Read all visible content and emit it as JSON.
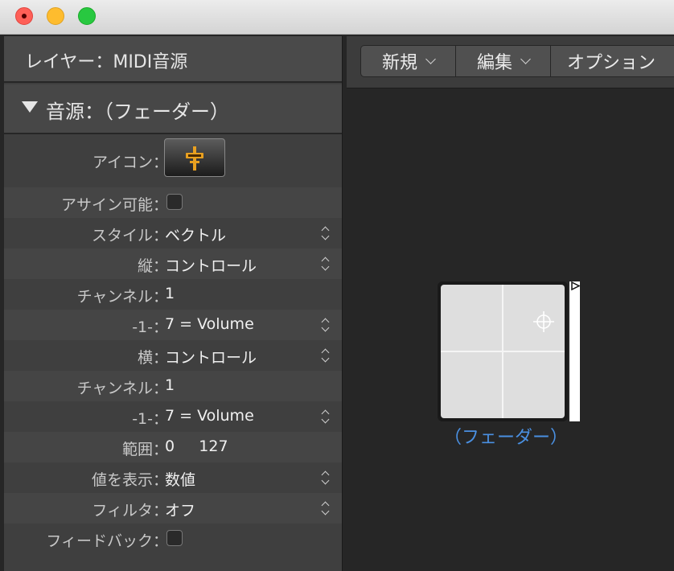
{
  "window": {
    "traffic_lights": [
      "close",
      "minimize",
      "zoom"
    ]
  },
  "inspector": {
    "header_title": "レイヤー：MIDI音源",
    "section_title": "音源：（フェーダー）",
    "rows": [
      {
        "label": "アイコン：",
        "type": "icon",
        "icon": "fader-icon"
      },
      {
        "label": "アサイン可能：",
        "type": "checkbox",
        "checked": false
      },
      {
        "label": "スタイル：",
        "value": "ベクトル",
        "type": "popup"
      },
      {
        "label": "縦：",
        "value": "コントロール",
        "type": "popup"
      },
      {
        "label": "チャンネル：",
        "value": "1",
        "type": "text"
      },
      {
        "label": "-1-：",
        "value": "7 = Volume",
        "type": "popup"
      },
      {
        "label": "横：",
        "value": "コントロール",
        "type": "popup"
      },
      {
        "label": "チャンネル：",
        "value": "1",
        "type": "text"
      },
      {
        "label": "-1-：",
        "value": "7 = Volume",
        "type": "popup"
      },
      {
        "label": "範囲：",
        "value": "0     127",
        "type": "text"
      },
      {
        "label": "値を表示：",
        "value": "数値",
        "type": "popup"
      },
      {
        "label": "フィルタ：",
        "value": "オフ",
        "type": "popup"
      },
      {
        "label": "フィードバック：",
        "type": "checkbox",
        "checked": false
      }
    ]
  },
  "toolbar": {
    "new_label": "新規",
    "edit_label": "編集",
    "options_label": "オプション"
  },
  "canvas": {
    "object_label": "（フェーダー）",
    "label_color": "#4a90e2"
  }
}
